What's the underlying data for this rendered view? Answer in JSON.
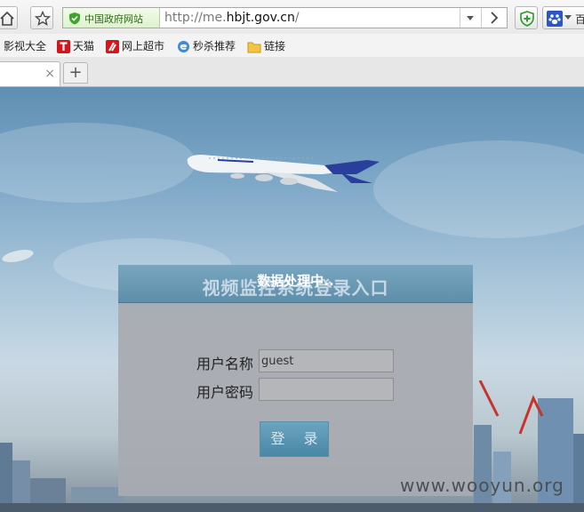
{
  "browser": {
    "site_badge": "中国政府网站",
    "url_prefix": "http://me.",
    "url_domain": "hbjt.gov.cn",
    "url_suffix": "/",
    "search_engine_label": "百"
  },
  "bookmarks": [
    {
      "label": "影视大全"
    },
    {
      "label": "天猫"
    },
    {
      "label": "网上超市"
    },
    {
      "label": "秒杀推荐"
    },
    {
      "label": "链接"
    }
  ],
  "tabs": {
    "close_glyph": "×",
    "new_tab_glyph": "+"
  },
  "page": {
    "system_title": "视频监控系统登录入口",
    "processing_text": "数据处理中..",
    "username_label": "用户名称",
    "username_value": "guest",
    "password_label": "用户密码",
    "password_value": "",
    "login_button": "登 录",
    "watermark": "www.wooyun.org"
  },
  "colors": {
    "header_bar": "#5f8eaa",
    "login_button": "#4a87a6",
    "panel": "#a8aab0"
  }
}
